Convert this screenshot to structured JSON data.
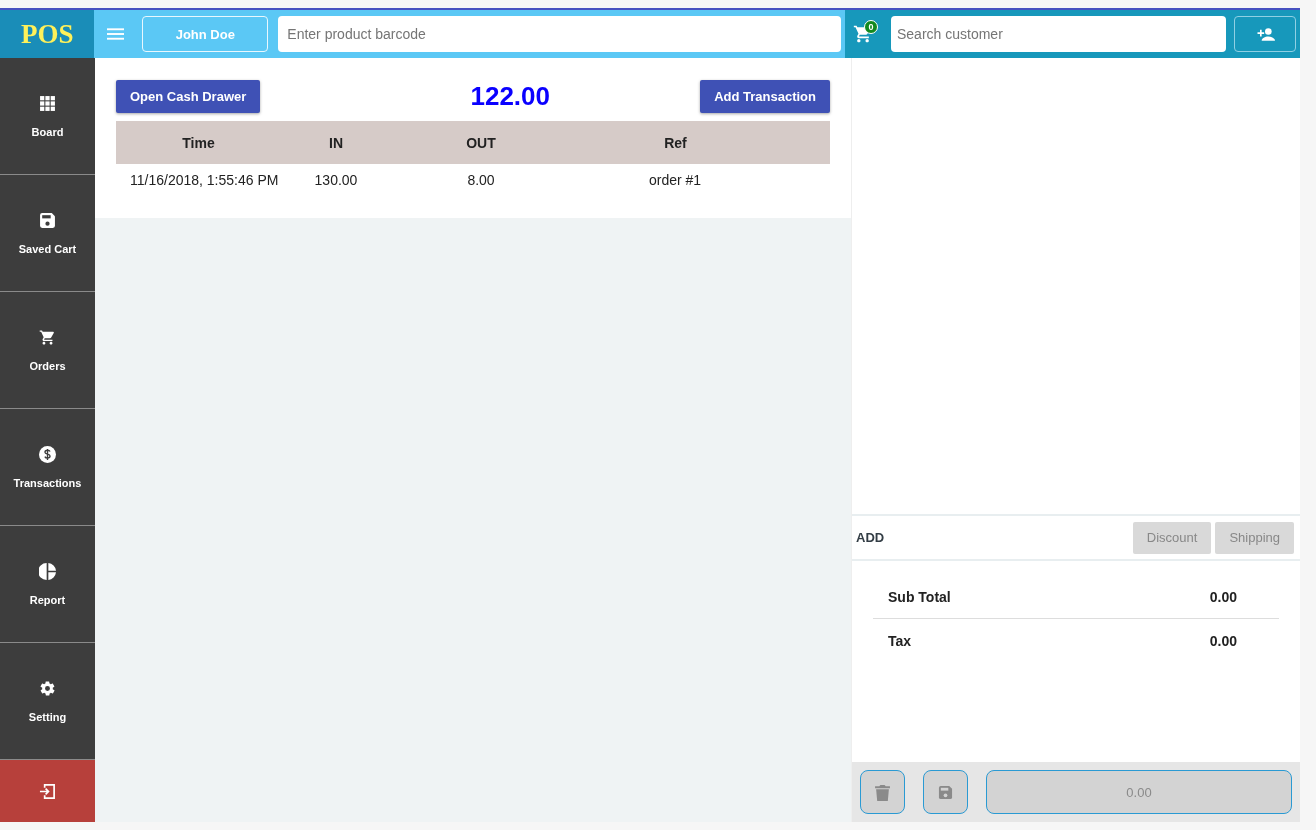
{
  "logo": "POS",
  "header": {
    "user": "John Doe",
    "barcode_placeholder": "Enter product barcode",
    "cart_count": "0",
    "customer_placeholder": "Search customer"
  },
  "sidebar": {
    "items": [
      {
        "label": "Board"
      },
      {
        "label": "Saved Cart"
      },
      {
        "label": "Orders"
      },
      {
        "label": "Transactions"
      },
      {
        "label": "Report"
      },
      {
        "label": "Setting"
      }
    ]
  },
  "cash": {
    "open_button": "Open Cash Drawer",
    "balance": "122.00",
    "add_button": "Add Transaction"
  },
  "table": {
    "columns": [
      "Time",
      "IN",
      "OUT",
      "Ref"
    ],
    "rows": [
      [
        "11/16/2018, 1:55:46 PM",
        "130.00",
        "8.00",
        "order #1"
      ]
    ]
  },
  "cart": {
    "add_label": "ADD",
    "buttons": [
      {
        "label": "Discount",
        "disabled": true
      },
      {
        "label": "Shipping",
        "disabled": true
      }
    ],
    "totals": [
      {
        "label": "Sub Total",
        "value": "0.00"
      },
      {
        "label": "Tax",
        "value": "0.00"
      }
    ],
    "pay_button": "0.00"
  }
}
